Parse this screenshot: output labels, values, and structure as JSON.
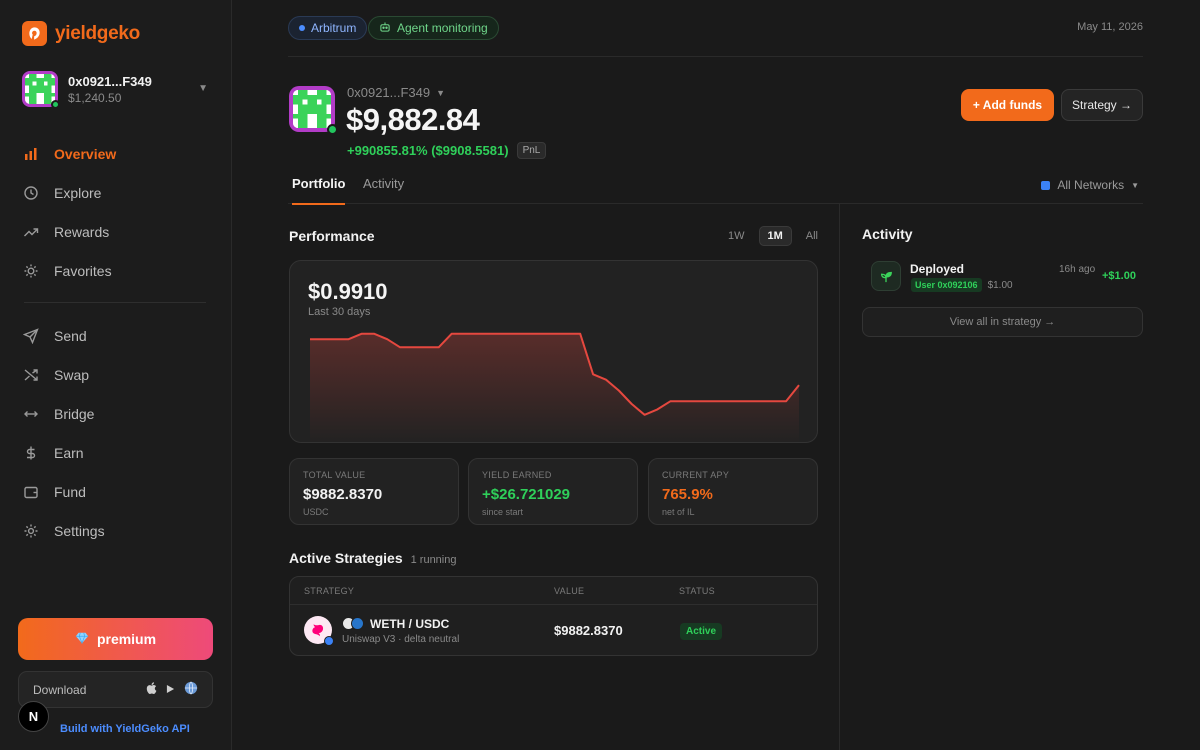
{
  "brand": {
    "name": "yieldgeko",
    "accent": "#f26a1b"
  },
  "wallet": {
    "address": "0x0921...F349",
    "balance": "$1,240.50"
  },
  "nav": {
    "items": [
      {
        "label": "Overview",
        "icon": "bar-chart-icon",
        "active": true
      },
      {
        "label": "Explore",
        "icon": "clock-icon"
      },
      {
        "label": "Rewards",
        "icon": "trending-up-icon"
      },
      {
        "label": "Favorites",
        "icon": "sun-icon"
      },
      {
        "label": "Send",
        "icon": "send-icon"
      },
      {
        "label": "Swap",
        "icon": "shuffle-icon"
      },
      {
        "label": "Bridge",
        "icon": "arrows-horizontal-icon"
      },
      {
        "label": "Earn",
        "icon": "dollar-icon"
      },
      {
        "label": "Fund",
        "icon": "wallet-icon"
      },
      {
        "label": "Settings",
        "icon": "settings-icon"
      }
    ]
  },
  "premium_label": "premium",
  "download_label": "Download",
  "n_badge": "N",
  "build_label": "Build with YieldGeko API",
  "topbar": {
    "network": "Arbitrum",
    "agent": "Agent monitoring",
    "date": "May 11, 2026"
  },
  "hero": {
    "address": "0x0921...F349",
    "value": "$9,882.84",
    "pnl": "+990855.81% ($9908.5581)",
    "pnl_badge": "PnL"
  },
  "buttons": {
    "add_funds": "+ Add funds",
    "strategy": "Strategy →"
  },
  "tabs": [
    {
      "label": "Portfolio",
      "active": true
    },
    {
      "label": "Activity"
    }
  ],
  "networks_label": "All Networks",
  "performance": {
    "title": "Performance",
    "ranges": [
      {
        "label": "1W"
      },
      {
        "label": "1M",
        "active": true
      },
      {
        "label": "All"
      }
    ],
    "value": "$0.9910",
    "subtitle": "Last 30 days"
  },
  "chart_data": {
    "type": "area",
    "title": "",
    "xlabel": "",
    "ylabel": "",
    "color": "#e5483f",
    "values": [
      1.0,
      1.0,
      1.0,
      1.0,
      1.002,
      1.002,
      1.0,
      0.997,
      0.997,
      0.997,
      0.997,
      1.002,
      1.002,
      1.002,
      1.002,
      1.002,
      1.002,
      1.002,
      1.002,
      1.002,
      1.002,
      1.002,
      0.987,
      0.985,
      0.981,
      0.976,
      0.972,
      0.974,
      0.977,
      0.977,
      0.977,
      0.977,
      0.977,
      0.977,
      0.977,
      0.977,
      0.977,
      0.977,
      0.983
    ],
    "ylim": [
      0.966,
      1.006
    ],
    "grid": false,
    "legend": "none"
  },
  "stats": [
    {
      "label": "TOTAL VALUE",
      "value": "$9882.8370",
      "sub": "USDC",
      "color": "#f2f2f2"
    },
    {
      "label": "YIELD EARNED",
      "value": "+$26.721029",
      "sub": "since start",
      "color": "#2fd05a"
    },
    {
      "label": "CURRENT APY",
      "value": "765.9%",
      "sub": "net of IL",
      "color": "#f26a1b"
    }
  ],
  "strategies": {
    "title": "Active Strategies",
    "count": "1 running",
    "headers": {
      "strategy": "STRATEGY",
      "value": "VALUE",
      "status": "STATUS"
    },
    "rows": [
      {
        "pair": "WETH / USDC",
        "sub": "Uniswap V3 · delta neutral",
        "value": "$9882.8370",
        "status": "Active"
      }
    ]
  },
  "activity": {
    "title": "Activity",
    "items": [
      {
        "label": "Deployed",
        "user": "User 0x092106",
        "user_amount": "$1.00",
        "time": "16h ago",
        "amount": "+$1.00"
      }
    ],
    "view_all": "View all in strategy →"
  }
}
